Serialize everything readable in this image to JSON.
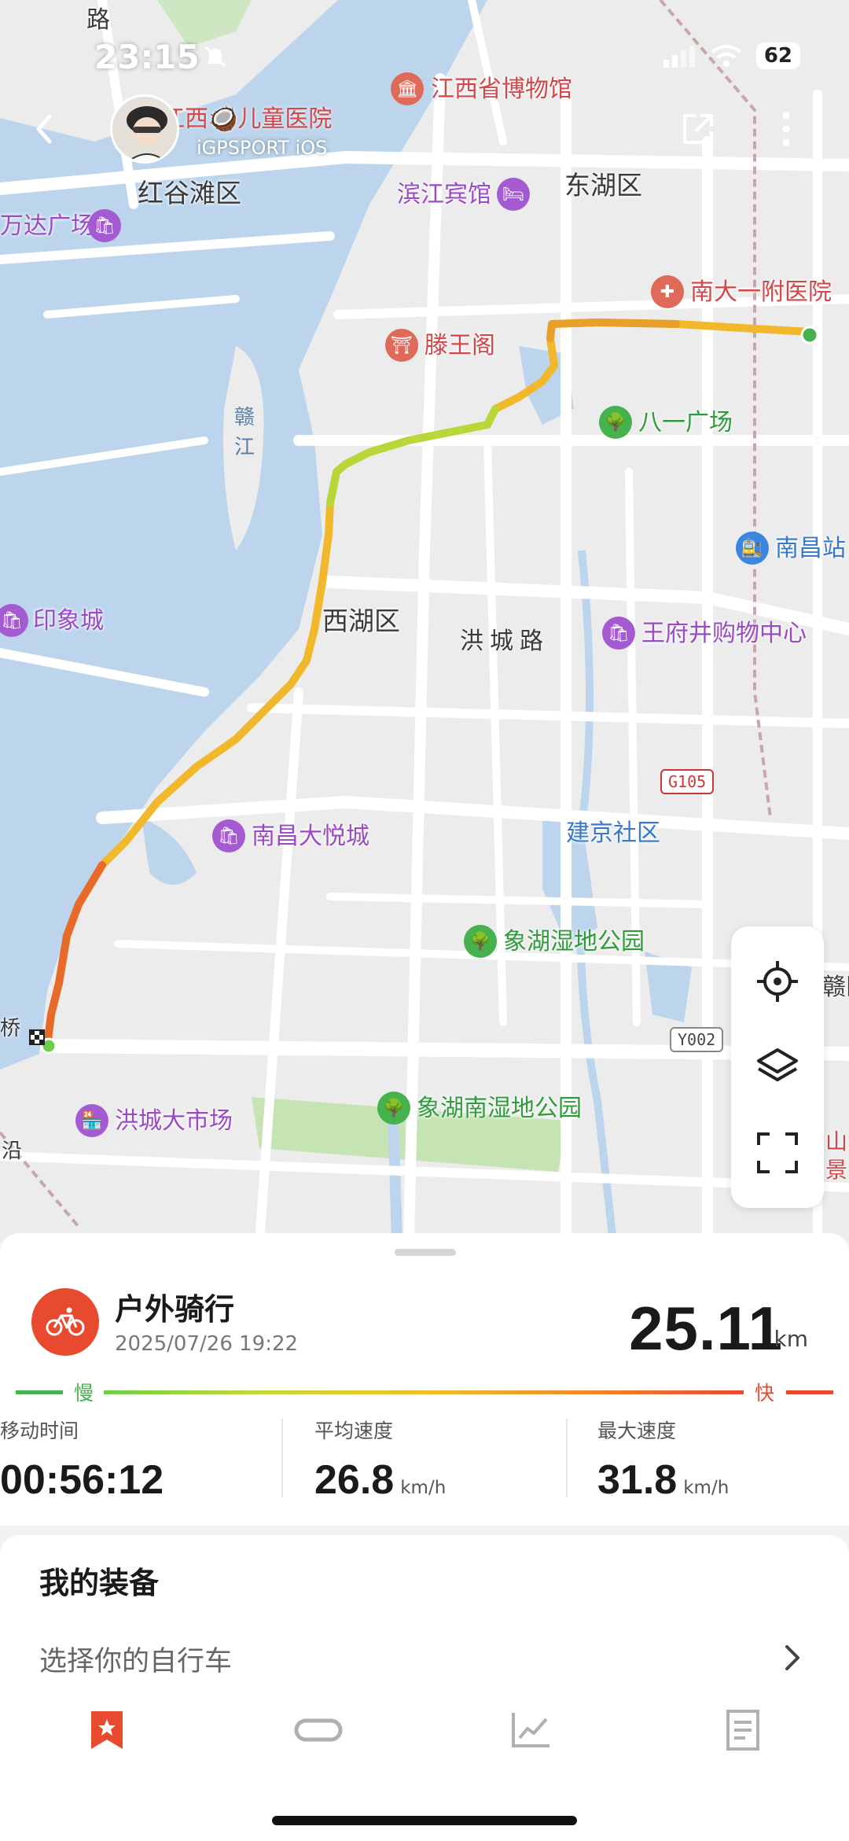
{
  "status_bar": {
    "time": "23:15",
    "battery": "62"
  },
  "header": {
    "user_name": "江西🥥儿童医院",
    "user_sub": "iGPSPORT iOS"
  },
  "map": {
    "districts": [
      "红谷滩区",
      "东湖区",
      "西湖区"
    ],
    "pois": {
      "museum": "江西省博物馆",
      "hotel": "滨江宾馆",
      "wanda": "万达广场",
      "hospital": "南大一附医院",
      "tengwang": "滕王阁",
      "bayi": "八一广场",
      "nanchang_station": "南昌站",
      "yinxiang": "印象城",
      "wangfujing": "王府井购物中心",
      "joycity": "南昌大悦城",
      "jianjing": "建京社区",
      "xianghu_wetland": "象湖湿地公园",
      "xianghu_south": "象湖南湿地公园",
      "hongcheng_market": "洪城大市场"
    },
    "road": "洪城路",
    "river": "赣江",
    "badges": [
      "G105",
      "Y002"
    ],
    "edge_labels": {
      "road_top": "路",
      "right_1": "赣区",
      "right_2a": "山",
      "right_2b": "景",
      "left_1": "桥",
      "left_2": "沿"
    }
  },
  "activity": {
    "type": "户外骑行",
    "datetime": "2025/07/26 19:22",
    "distance": "25.11",
    "distance_unit": "km",
    "speed_slow": "慢",
    "speed_fast": "快",
    "stats": [
      {
        "label": "移动时间",
        "value": "00:56:12",
        "unit": ""
      },
      {
        "label": "平均速度",
        "value": "26.8",
        "unit": "km/h"
      },
      {
        "label": "最大速度",
        "value": "31.8",
        "unit": "km/h"
      }
    ]
  },
  "equipment": {
    "title": "我的装备",
    "select_bike": "选择你的自行车"
  },
  "colors": {
    "accent": "#e84a2f",
    "slow": "#46b24e",
    "tab_active": "#e84a2f",
    "tab_inactive": "#b0b0b0"
  },
  "tabs": [
    "bookmark-icon",
    "lap-icon",
    "chart-icon",
    "document-icon"
  ]
}
